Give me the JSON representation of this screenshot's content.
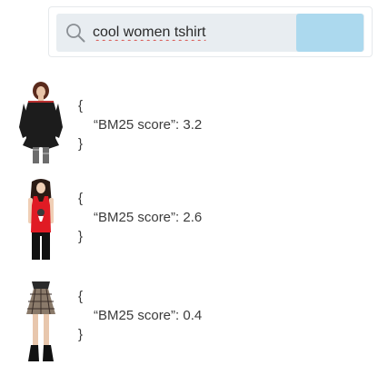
{
  "search": {
    "query": "cool women tshirt",
    "button_color": "#acd9ee"
  },
  "results": [
    {
      "open_brace": "{",
      "score_line": "“BM25 score”: 3.2",
      "close_brace": "}",
      "score": 3.2,
      "image": "black-long-sleeve-top"
    },
    {
      "open_brace": "{",
      "score_line": "“BM25 score”: 2.6",
      "close_brace": "}",
      "score": 2.6,
      "image": "red-tank-top"
    },
    {
      "open_brace": "{",
      "score_line": "“BM25 score”: 0.4",
      "close_brace": "}",
      "score": 0.4,
      "image": "plaid-skirt"
    }
  ]
}
